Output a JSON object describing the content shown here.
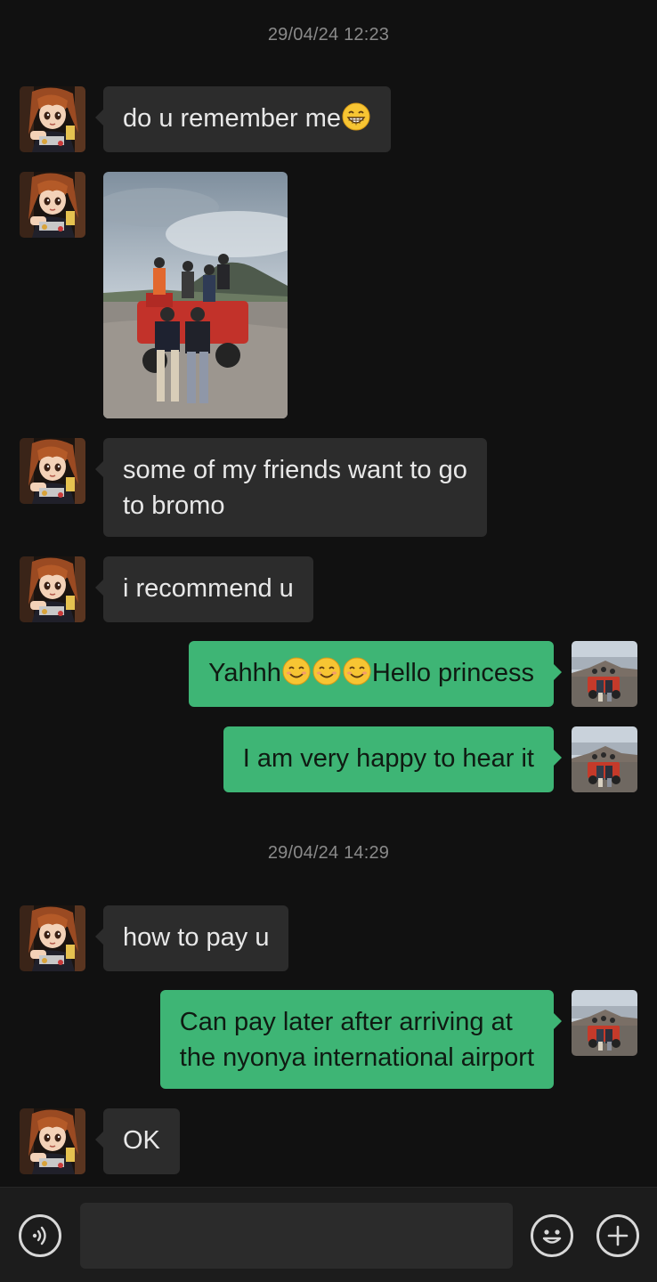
{
  "conversation": {
    "timestamps": [
      "29/04/24 12:23",
      "29/04/24 14:29"
    ],
    "messages": [
      {
        "from": "them",
        "text": "do u remember me",
        "emoji": "grinning-face"
      },
      {
        "from": "them",
        "type": "photo"
      },
      {
        "from": "them",
        "lines": [
          "some of my friends want to go",
          "to bromo"
        ]
      },
      {
        "from": "them",
        "text": "i recommend u"
      },
      {
        "from": "me",
        "text_before": "Yahhh",
        "emoji_count": 3,
        "emoji": "smiling-face",
        "text_after": "Hello princess"
      },
      {
        "from": "me",
        "text": "I am very happy to hear it"
      },
      {
        "from": "them",
        "text": "how to pay u"
      },
      {
        "from": "me",
        "lines": [
          "Can pay later after arriving at",
          "the nyonya international airport"
        ]
      },
      {
        "from": "them",
        "text": "OK"
      }
    ]
  },
  "input_bar": {
    "message_value": "",
    "icons": [
      "voice-icon",
      "emoji-icon",
      "plus-icon"
    ]
  },
  "colors": {
    "background": "#111111",
    "incoming_bubble": "#2c2c2c",
    "outgoing_bubble": "#3eb575",
    "timestamp_text": "#8a8a8a"
  }
}
